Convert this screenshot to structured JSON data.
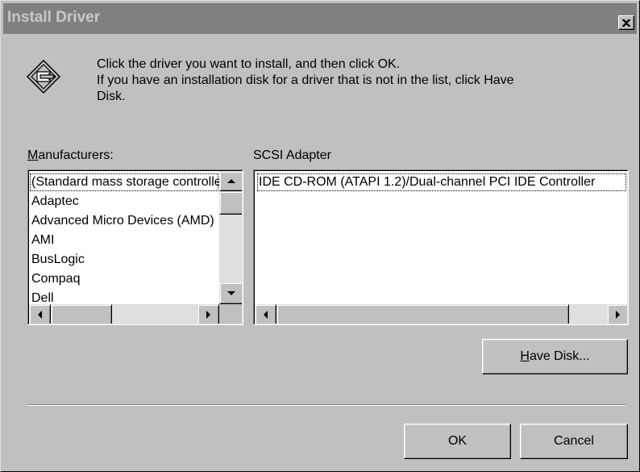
{
  "window": {
    "title": "Install Driver",
    "close_icon": "close-icon"
  },
  "instructions": {
    "line1": "Click the driver you want to install, and then click OK.",
    "line2": "If you have an installation disk for a driver that is not in the list, click Have",
    "line3": "Disk."
  },
  "manufacturers": {
    "label_accel": "M",
    "label_rest": "anufacturers:",
    "items": [
      "(Standard mass storage controllers)",
      "Adaptec",
      "Advanced Micro Devices (AMD)",
      "AMI",
      "BusLogic",
      "Compaq",
      "Dell"
    ]
  },
  "adapter": {
    "label": "SCSI Adapter",
    "items": [
      "IDE CD-ROM (ATAPI 1.2)/Dual-channel PCI IDE Controller"
    ]
  },
  "buttons": {
    "have_disk_accel": "H",
    "have_disk_rest": "ave Disk...",
    "ok": "OK",
    "cancel": "Cancel"
  },
  "colors": {
    "face": "#c0c0c0",
    "title_inactive": "#808080",
    "title_text": "#c8c8c8"
  }
}
